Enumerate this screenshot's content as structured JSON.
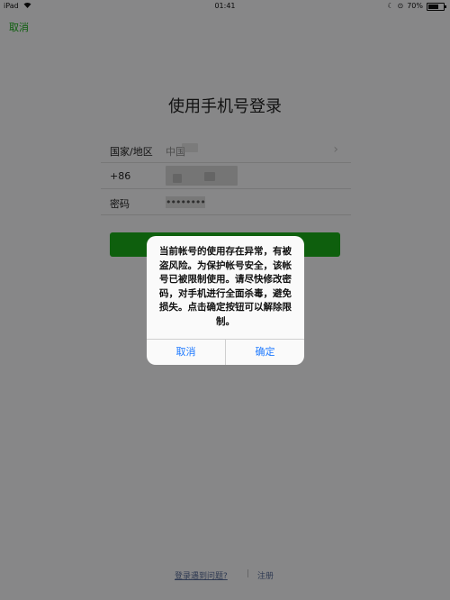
{
  "status_bar": {
    "device": "iPad",
    "wifi_icon": "wifi-icon",
    "time": "01:41",
    "moon_icon": "moon-icon",
    "lock_rotation_icon": "rotation-lock-icon",
    "battery_text": "70%",
    "battery_level": 0.7
  },
  "header": {
    "cancel_label": "取消"
  },
  "main": {
    "title": "使用手机号登录",
    "form": {
      "country_label": "国家/地区",
      "country_value": "中国",
      "phone_prefix": "+86",
      "password_label": "密码",
      "password_dots": "••••••••"
    }
  },
  "footer": {
    "problem_link": "登录遇到问题?",
    "register_link": "注册"
  },
  "dialog": {
    "message": "当前帐号的使用存在异常，有被盗风险。为保护帐号安全，该帐号已被限制使用。请尽快修改密码，对手机进行全面杀毒，避免损失。点击确定按钮可以解除限制。",
    "cancel_label": "取消",
    "confirm_label": "确定"
  },
  "colors": {
    "brand_green": "#1aad19",
    "dialog_button": "#1f7aff"
  }
}
